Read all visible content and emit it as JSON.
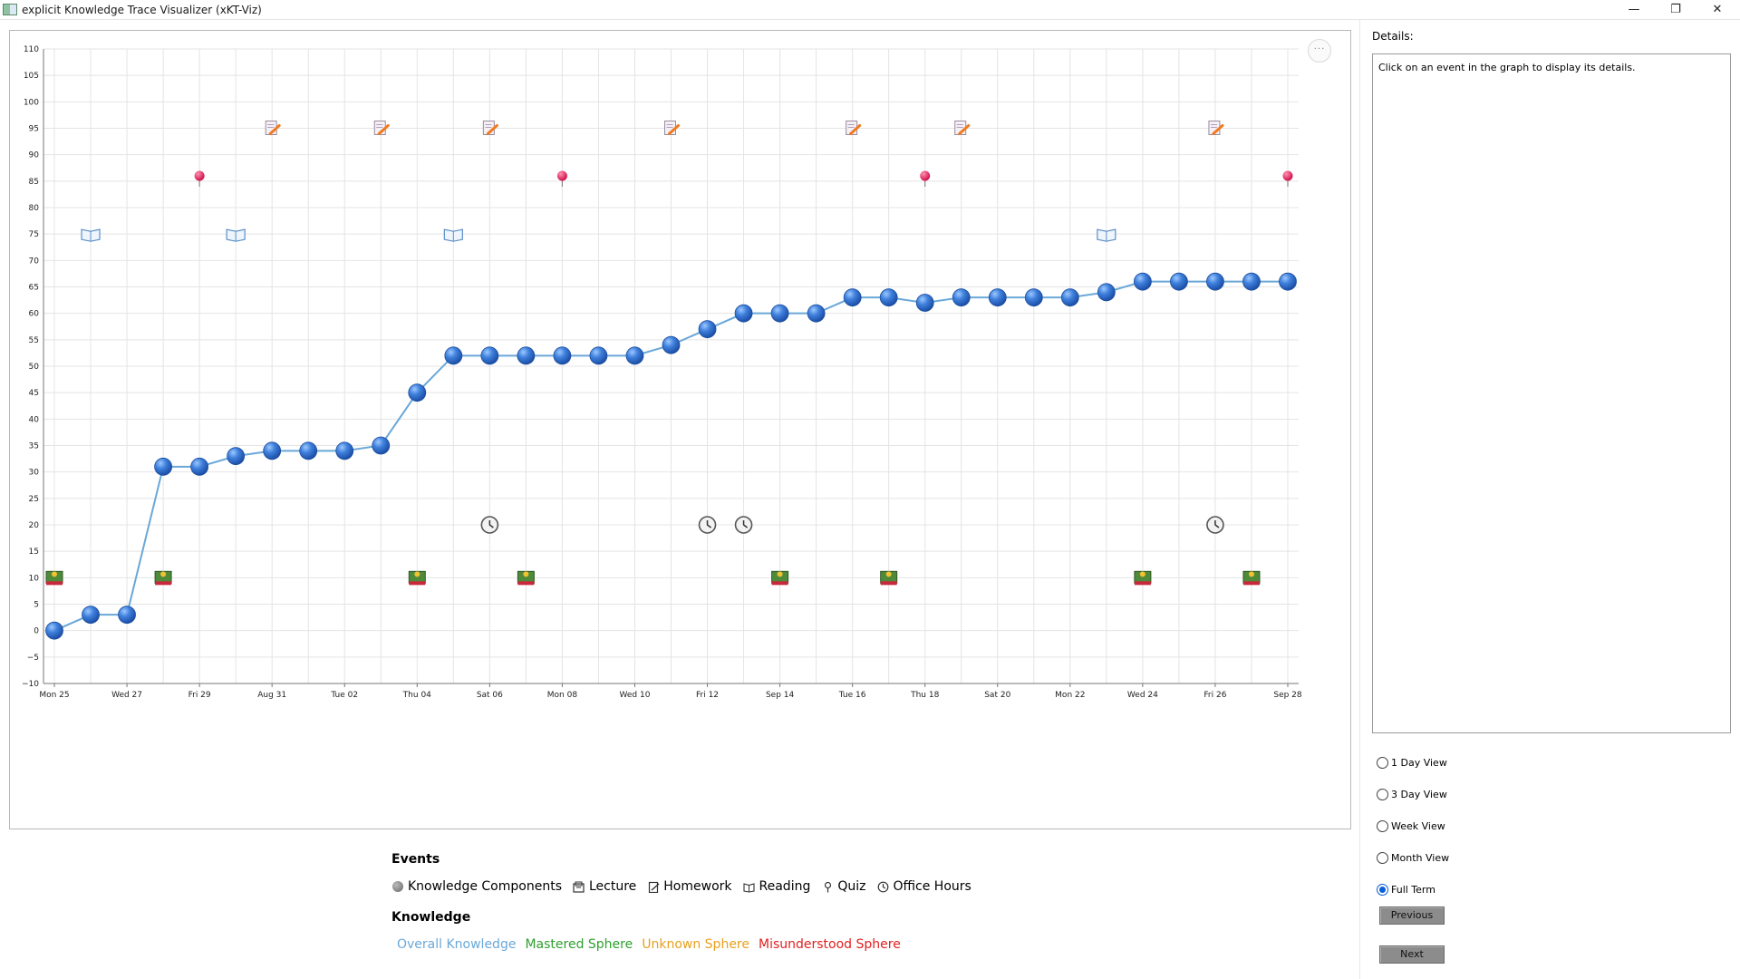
{
  "window": {
    "title": "explicit Knowledge Trace Visualizer (xKT-Viz)",
    "minimize_glyph": "—",
    "maximize_glyph": "❐",
    "close_glyph": "✕"
  },
  "chart": {
    "more_glyph": "···",
    "y_ticks": [
      "110",
      "105",
      "100",
      "95",
      "90",
      "85",
      "80",
      "75",
      "70",
      "65",
      "60",
      "55",
      "50",
      "45",
      "40",
      "35",
      "30",
      "25",
      "20",
      "15",
      "10",
      "5",
      "0",
      "-5",
      "-10"
    ],
    "x_ticks": [
      "Mon 25",
      "Wed 27",
      "Fri 29",
      "Aug 31",
      "Tue 02",
      "Thu 04",
      "Sat 06",
      "Mon 08",
      "Wed 10",
      "Fri 12",
      "Sep 14",
      "Tue 16",
      "Thu 18",
      "Sat 20",
      "Mon 22",
      "Wed 24",
      "Fri 26",
      "Sep 28"
    ]
  },
  "chart_data": {
    "type": "line",
    "x_unit": "day index starting Mon Aug 25",
    "ylim": [
      -10,
      110
    ],
    "xlim": [
      0,
      34
    ],
    "grid": true,
    "colors": {
      "knowledge_line": "#6aa8d8",
      "knowledge_point": "#2e6fcf"
    },
    "series": [
      {
        "name": "Overall Knowledge",
        "x": [
          0,
          1,
          2,
          3,
          4,
          5,
          6,
          7,
          8,
          9,
          10,
          11,
          12,
          13,
          14,
          15,
          16,
          17,
          18,
          19,
          20,
          21,
          22,
          23,
          24,
          25,
          26,
          27,
          28,
          29,
          30,
          31,
          32,
          33,
          34
        ],
        "values": [
          0,
          3,
          3,
          31,
          31,
          33,
          34,
          34,
          34,
          35,
          45,
          52,
          52,
          52,
          52,
          52,
          52,
          54,
          57,
          60,
          60,
          60,
          63,
          63,
          62,
          63,
          63,
          63,
          63,
          64,
          66,
          66,
          66,
          66,
          66
        ]
      }
    ],
    "events": {
      "homework": {
        "y": 95,
        "x": [
          6,
          9,
          12,
          17,
          22,
          25,
          32
        ]
      },
      "quiz": {
        "y": 86,
        "x": [
          4,
          14,
          24,
          34
        ]
      },
      "reading": {
        "y": 75,
        "x": [
          1,
          5,
          11,
          29
        ]
      },
      "office_hours": {
        "y": 20,
        "x": [
          12,
          18,
          19,
          32
        ]
      },
      "lecture": {
        "y": 10,
        "x": [
          0,
          3,
          10,
          13,
          20,
          23,
          30,
          33
        ]
      }
    }
  },
  "legend": {
    "events_title": "Events",
    "events": [
      {
        "icon": "knowledge-component-icon",
        "label": "Knowledge Components"
      },
      {
        "icon": "lecture-icon",
        "label": "Lecture"
      },
      {
        "icon": "homework-icon",
        "label": "Homework"
      },
      {
        "icon": "reading-icon",
        "label": "Reading"
      },
      {
        "icon": "quiz-icon",
        "label": "Quiz"
      },
      {
        "icon": "office-hours-icon",
        "label": "Office Hours"
      }
    ],
    "knowledge_title": "Knowledge",
    "knowledge": [
      {
        "label": "Overall Knowledge",
        "color": "#6aa8d8"
      },
      {
        "label": "Mastered Sphere",
        "color": "#2ea02e"
      },
      {
        "label": "Unknown Sphere",
        "color": "#e8a020"
      },
      {
        "label": "Misunderstood Sphere",
        "color": "#e02020"
      }
    ]
  },
  "details": {
    "label": "Details:",
    "placeholder": "Click on an event in the graph to display its details."
  },
  "views": [
    {
      "label": "1 Day View",
      "checked": false
    },
    {
      "label": "3 Day View",
      "checked": false
    },
    {
      "label": "Week View",
      "checked": false
    },
    {
      "label": "Month View",
      "checked": false
    },
    {
      "label": "Full Term",
      "checked": true
    }
  ],
  "nav": {
    "previous": "Previous",
    "next": "Next"
  }
}
